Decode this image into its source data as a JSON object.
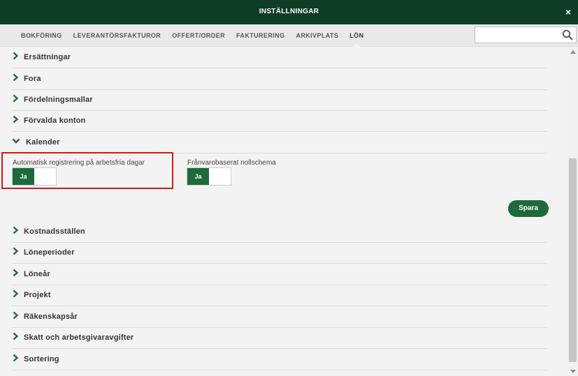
{
  "window": {
    "title": "INSTÄLLNINGAR",
    "close_label": "×"
  },
  "tabs": [
    {
      "label": "BOKFÖRING"
    },
    {
      "label": "LEVERANTÖRSFAKTUROR"
    },
    {
      "label": "OFFERT/ORDER"
    },
    {
      "label": "FAKTURERING"
    },
    {
      "label": "ARKIVPLATS"
    },
    {
      "label": "LÖN",
      "active": true
    }
  ],
  "search": {
    "value": "",
    "placeholder": ""
  },
  "sections_before": [
    {
      "label": "Ersättningar"
    },
    {
      "label": "Fora"
    },
    {
      "label": "Fördelningsmallar"
    },
    {
      "label": "Förvalda konton"
    }
  ],
  "expanded_section": {
    "label": "Kalender",
    "settings": [
      {
        "label": "Automatisk registrering på arbetsfria dagar",
        "toggle": "Ja"
      },
      {
        "label": "Frånvarobaserat nollschema",
        "toggle": "Ja"
      }
    ],
    "save_label": "Spara"
  },
  "sections_after": [
    {
      "label": "Kostnadsställen"
    },
    {
      "label": "Löneperioder"
    },
    {
      "label": "Löneår"
    },
    {
      "label": "Projekt"
    },
    {
      "label": "Räkenskapsår"
    },
    {
      "label": "Skatt och arbetsgivaravgifter"
    },
    {
      "label": "Sortering"
    }
  ],
  "colors": {
    "header_bg": "#0e3d26",
    "accent_green": "#1f6a3c",
    "highlight_red": "#d0191b"
  },
  "icons": {
    "collapsed": "chevron-right-icon",
    "expanded": "chevron-down-icon",
    "search": "search-icon",
    "close": "close-icon"
  }
}
